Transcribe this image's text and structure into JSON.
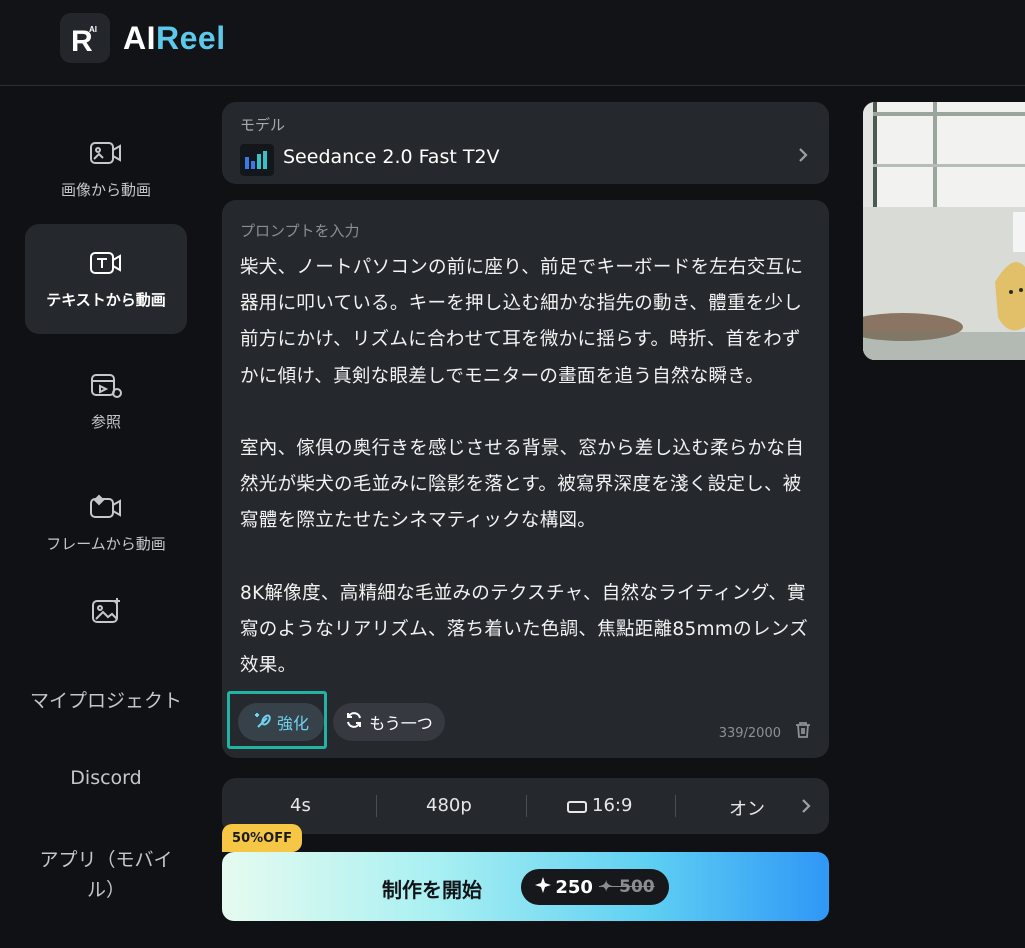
{
  "app": {
    "logo_mark": "R",
    "name_part1": "AI",
    "name_part2": "Reel"
  },
  "sidebar": {
    "items": [
      {
        "label": "画像から動画",
        "icon": "image-video-icon"
      },
      {
        "label": "テキストから動画",
        "icon": "text-video-icon"
      },
      {
        "label": "参照",
        "icon": "reference-icon"
      },
      {
        "label": "フレームから動画",
        "icon": "frame-video-icon"
      },
      {
        "label": "",
        "icon": "image-sparkle-icon"
      }
    ],
    "links": [
      "マイプロジェクト",
      "Discord",
      "アプリ（モバイル）"
    ]
  },
  "model": {
    "label": "モデル",
    "name": "Seedance 2.0 Fast T2V"
  },
  "prompt": {
    "label": "プロンプトを入力",
    "text": "柴犬、ノートパソコンの前に座り、前足でキーボードを左右交互に器用に叩いている。キーを押し込む細かな指先の動き、體重を少し前方にかけ、リズムに合わせて耳を微かに揺らす。時折、首をわずかに傾け、真剣な眼差しでモニターの畫面を追う自然な瞬き。\n\n室內、傢俱の奥行きを感じさせる背景、窓から差し込む柔らかな自然光が柴犬の毛並みに陰影を落とす。被寫界深度を淺く設定し、被寫體を際立たせたシネマティックな構図。\n\n8K解像度、高精細な毛並みのテクスチャ、自然なライティング、實寫のようなリアリズム、落ち着いた色調、焦點距離85mmのレンズ效果。",
    "enhance_label": "強化",
    "another_label": "もう一つ",
    "char_count": "339/2000"
  },
  "settings": {
    "duration": "4s",
    "resolution": "480p",
    "ratio": "16:9",
    "toggle": "オン"
  },
  "discount_badge": "50%OFF",
  "start": {
    "label": "制作を開始",
    "cost": "250",
    "old_cost": "500"
  },
  "colors": {
    "accent": "#5cc9ea",
    "highlight": "#23b3a4",
    "badge": "#f6c744"
  }
}
